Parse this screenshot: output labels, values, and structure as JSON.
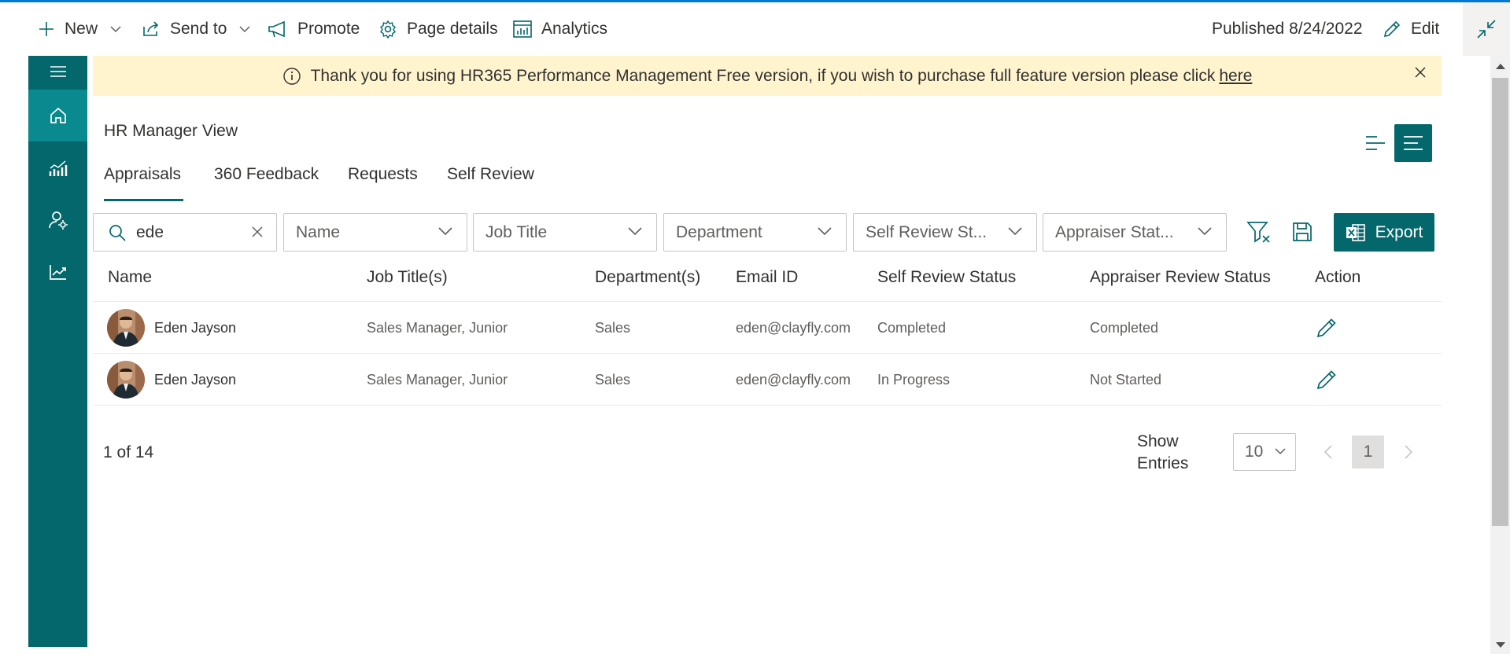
{
  "command_bar": {
    "new_label": "New",
    "send_to_label": "Send to",
    "promote_label": "Promote",
    "page_details_label": "Page details",
    "analytics_label": "Analytics",
    "published_label": "Published 8/24/2022",
    "edit_label": "Edit"
  },
  "rail": {
    "items": [
      "menu-icon",
      "home-icon",
      "reports-icon",
      "user-settings-icon",
      "trend-icon"
    ],
    "active": "home-icon"
  },
  "banner": {
    "message": "Thank you for using HR365 Performance Management Free version, if you wish to purchase full feature version please click",
    "link_text": "here"
  },
  "view_title": "HR Manager View",
  "tabs": [
    {
      "label": "Appraisals"
    },
    {
      "label": "360 Feedback"
    },
    {
      "label": "Requests"
    },
    {
      "label": "Self Review"
    }
  ],
  "active_tab": "Appraisals",
  "filters": {
    "search_value": "ede",
    "name_placeholder": "Name",
    "job_title_placeholder": "Job Title",
    "department_placeholder": "Department",
    "self_review_placeholder": "Self Review St...",
    "appraiser_placeholder": "Appraiser Stat..."
  },
  "export_label": "Export",
  "table": {
    "headers": [
      "Name",
      "Job Title(s)",
      "Department(s)",
      "Email ID",
      "Self Review Status",
      "Appraiser Review Status",
      "Action"
    ],
    "rows": [
      {
        "name": "Eden Jayson",
        "job_title": "Sales Manager, Junior",
        "department": "Sales",
        "email": "eden@clayfly.com",
        "self_review": "Completed",
        "appraiser_review": "Completed"
      },
      {
        "name": "Eden Jayson",
        "job_title": "Sales Manager, Junior",
        "department": "Sales",
        "email": "eden@clayfly.com",
        "self_review": "In Progress",
        "appraiser_review": "Not Started"
      }
    ]
  },
  "pagination": {
    "count_text": "1 of 14",
    "show_entries_label": "Show Entries",
    "page_size": "10",
    "current_page": "1"
  },
  "colors": {
    "accent": "#03676b",
    "rail_active": "#0a8a8f",
    "banner_bg": "#fff4ce",
    "top_line": "#0078d4"
  }
}
